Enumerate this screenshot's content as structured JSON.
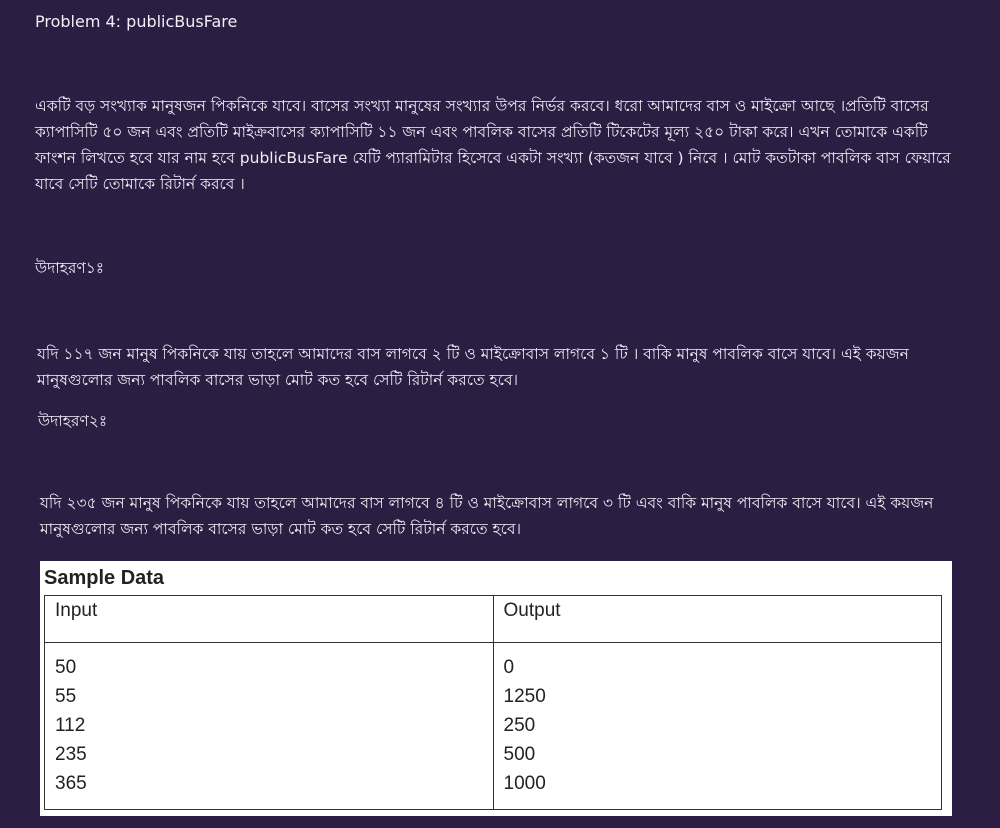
{
  "title": "Problem 4: publicBusFare",
  "description": "একটি বড় সংখ্যাক মানুষজন পিকনিকে যাবে। বাসের সংখ্যা মানুষের সংখ্যার উপর নির্ভর করবে। ধরো আমাদের বাস ও মাইক্রো আছে ।প্রতিটি বাসের ক্যাপাসিটি ৫০ জন এবং প্রতিটি মাইক্রবাসের ক্যাপাসিটি ১১ জন এবং পাবলিক বাসের প্রতিটি টিকেটের মূল্য ২৫০ টাকা করে। এখন তোমাকে একটি ফাংশন লিখতে হবে যার নাম হবে publicBusFare যেটি প্যারামিটার হিসেবে একটা সংখ্যা (কতজন যাবে )  নিবে । মোট কতটাকা পাবলিক বাস ফেয়ারে যাবে সেটি তোমাকে রিটার্ন করবে ।",
  "example1": {
    "label": "উদাহরণ১ঃ",
    "text": "যদি ১১৭ জন মানুষ পিকনিকে যায় তাহলে আমাদের বাস লাগবে ২ টি ও মাইক্রোবাস লাগবে ১ টি । বাকি মানুষ পাবলিক বাসে যাবে। এই কয়জন মানুষগুলোর জন্য পাবলিক বাসের ভাড়া মোট কত হবে সেটি রিটার্ন করতে হবে।"
  },
  "example2": {
    "label": "উদাহরণ২ঃ",
    "text": "যদি ২৩৫ জন মানুষ পিকনিকে যায় তাহলে আমাদের বাস লাগবে ৪ টি ও মাইক্রোবাস লাগবে ৩ টি এবং বাকি মানুষ পাবলিক বাসে যাবে। এই কয়জন মানুষগুলোর জন্য পাবলিক বাসের ভাড়া মোট কত হবে সেটি রিটার্ন করতে হবে।"
  },
  "sample": {
    "title": "Sample Data",
    "headers": [
      "Input",
      "Output"
    ],
    "inputs": "50\n55\n112\n235\n365",
    "outputs": "0\n1250\n250\n500\n1000"
  }
}
